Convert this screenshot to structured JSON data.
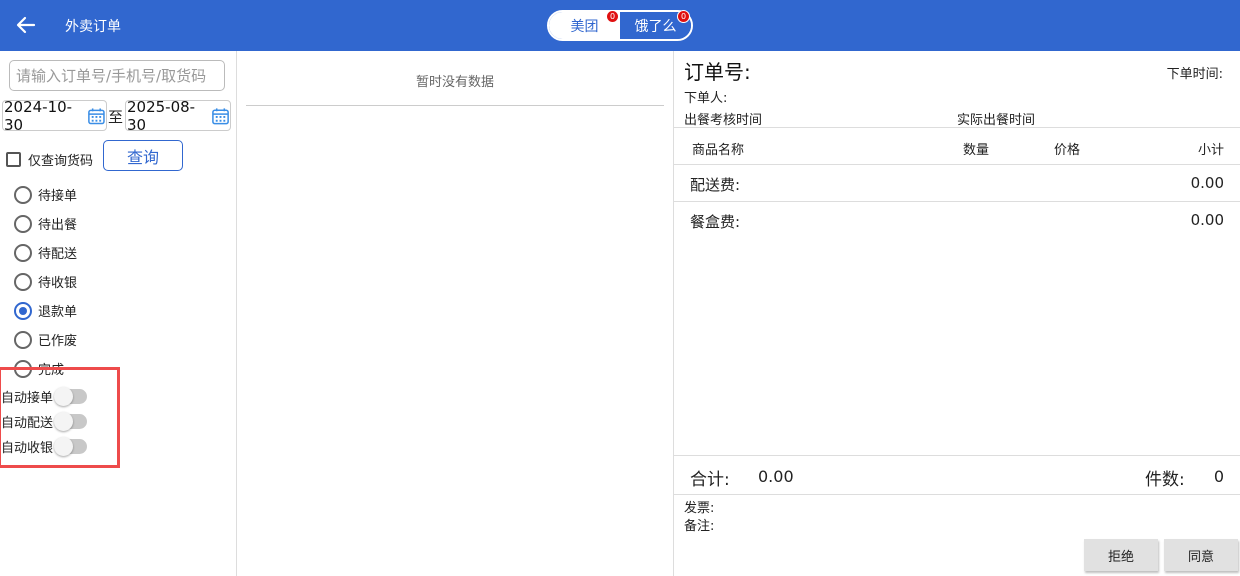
{
  "header": {
    "title": "外卖订单",
    "tabs": [
      {
        "label": "美团",
        "badge": "0"
      },
      {
        "label": "饿了么",
        "badge": "0"
      }
    ]
  },
  "filters": {
    "search_placeholder": "请输入订单号/手机号/取货码",
    "date_from": "2024-10-30",
    "date_to_sep": "至",
    "date_to": "2025-08-30",
    "checkbox_label": "仅查询货码",
    "query_label": "查询",
    "statuses": [
      {
        "label": "待接单",
        "selected": false
      },
      {
        "label": "待出餐",
        "selected": false
      },
      {
        "label": "待配送",
        "selected": false
      },
      {
        "label": "待收银",
        "selected": false
      },
      {
        "label": "退款单",
        "selected": true
      },
      {
        "label": "已作废",
        "selected": false
      },
      {
        "label": "完成",
        "selected": false
      }
    ],
    "switches": [
      {
        "label": "自动接单",
        "on": false
      },
      {
        "label": "自动配送",
        "on": false
      },
      {
        "label": "自动收银",
        "on": false
      }
    ]
  },
  "list": {
    "empty_text": "暂时没有数据"
  },
  "detail": {
    "order_no_label": "订单号:",
    "order_time_label": "下单时间:",
    "orderer_label": "下单人:",
    "check_time_label": "出餐考核时间",
    "actual_time_label": "实际出餐时间",
    "columns": [
      "商品名称",
      "数量",
      "价格",
      "小计"
    ],
    "delivery_fee_label": "配送费:",
    "delivery_fee_value": "0.00",
    "box_fee_label": "餐盒费:",
    "box_fee_value": "0.00",
    "total_label": "合计:",
    "total_value": "0.00",
    "count_label": "件数:",
    "count_value": "0",
    "invoice_label": "发票:",
    "remark_label": "备注:",
    "reject_label": "拒绝",
    "agree_label": "同意"
  },
  "colors": {
    "primary": "#3167cf",
    "badge": "#e01010",
    "highlight": "#ee4b4b"
  }
}
